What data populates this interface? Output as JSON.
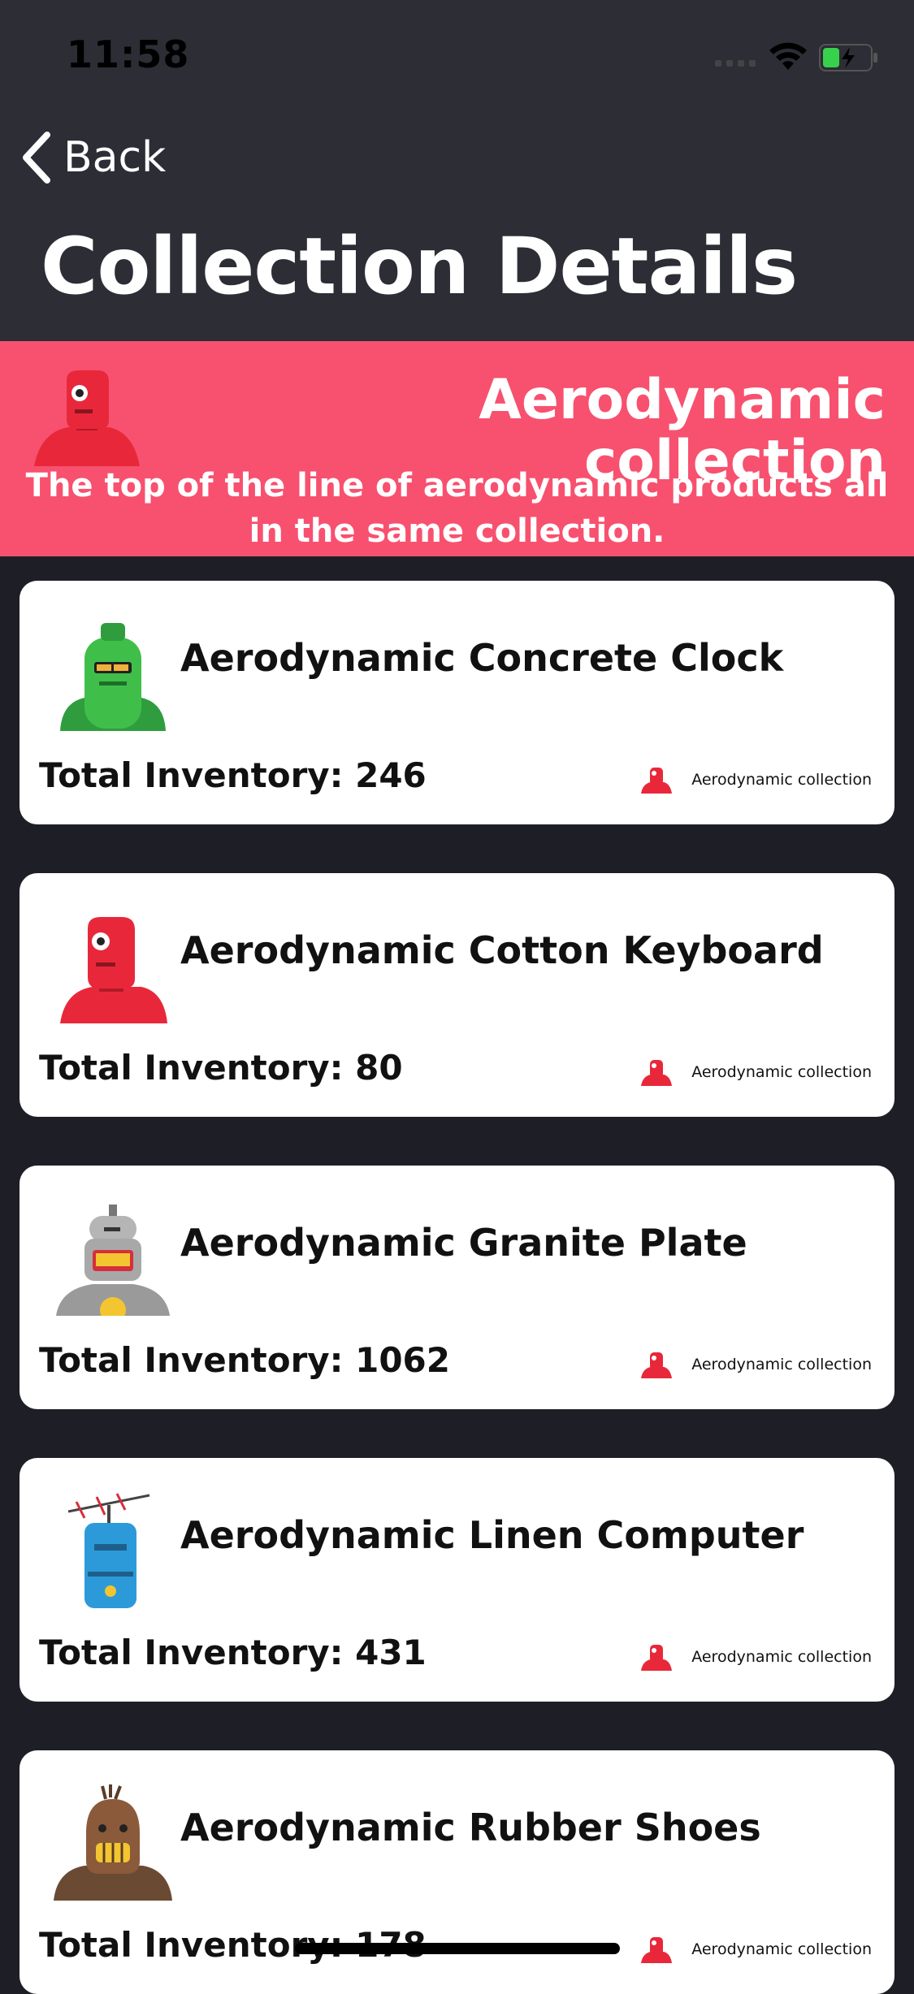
{
  "status_bar": {
    "time": "11:58"
  },
  "nav": {
    "back_label": "Back",
    "title": "Collection Details"
  },
  "collection": {
    "name": "Aerodynamic collection",
    "description": "The top of the line of aerodynamic products all in the same collection.",
    "robot_color": "#e8283a"
  },
  "colors": {
    "banner": "#f7516f",
    "background": "#1e1f26",
    "header": "#2c2d35"
  },
  "products": [
    {
      "name": "Aerodynamic Concrete Clock",
      "inventory": "Total Inventory: 246",
      "collection": "Aerodynamic collection",
      "robot": "green-robot-icon"
    },
    {
      "name": "Aerodynamic Cotton Keyboard",
      "inventory": "Total Inventory: 80",
      "collection": "Aerodynamic collection",
      "robot": "red-robot-icon"
    },
    {
      "name": "Aerodynamic Granite Plate",
      "inventory": "Total Inventory: 1062",
      "collection": "Aerodynamic collection",
      "robot": "gray-robot-icon"
    },
    {
      "name": "Aerodynamic Linen Computer",
      "inventory": "Total Inventory: 431",
      "collection": "Aerodynamic collection",
      "robot": "blue-robot-icon"
    },
    {
      "name": "Aerodynamic Rubber Shoes",
      "inventory": "Total Inventory: 178",
      "collection": "Aerodynamic collection",
      "robot": "brown-robot-icon"
    }
  ]
}
